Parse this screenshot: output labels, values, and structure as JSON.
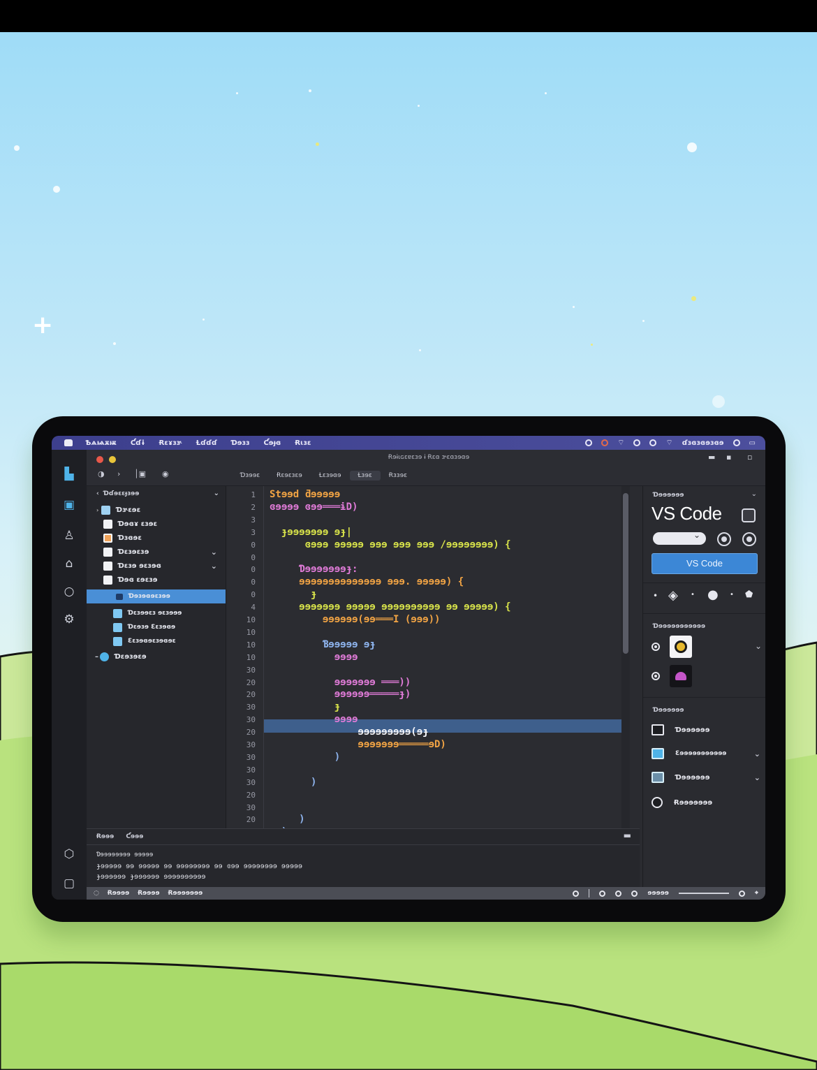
{
  "menubar": {
    "items": [
      "Ѣѧѩѫѭ",
      "Ƈɗɨ",
      "Ɍɛɤɜɝ",
      "Ɫɗɗɗ",
      "Ɗɘɜɜ",
      "Ƈɘɟɞ",
      "Ɍɩɜɛ"
    ],
    "clock": "ɗɜɞɜɞɘɜɞɘ"
  },
  "window": {
    "title": "Ɍɘɨɩɢɛɐɛɜɘ ɨ Ɍɛɞ ɝɛɞɜɘɞɘ"
  },
  "editor_tabs": [
    "Ɗɜɘɘɛ",
    "Ɍɛɘɛɜɛɘ",
    "Ɫɛɜɘɞɘ",
    "Ɫɜɘɛ",
    "Ɍɜɜɘɛ"
  ],
  "explorer": {
    "header": "Ɗɗɘɛɛɟɜɘɘ",
    "items": [
      {
        "label": "Ɗɝɛɘɛ"
      },
      {
        "label": "Ɗɘɞɤ ɛɜɘɛ"
      },
      {
        "label": "Ɗɜɞɘɛ"
      },
      {
        "label": "Ɗɛɜɘɛɜɘ"
      },
      {
        "label": "Ɗɛɜɘ ɘɛɜɘɞ"
      },
      {
        "label": "Ɗɘɞ ɛɘɛɜɘ"
      },
      {
        "label": "Ɗɘɜɘɞɘɛɜɘɘ"
      },
      {
        "label": "Ɗɛɜɘɘɛɜ ɘɛɜɘɘɘ"
      },
      {
        "label": "Ɗɛɘɜɘ Ɛɛɜɘɞɘ"
      },
      {
        "label": "Ɛɛɜɘɞɘɛɜɘɞɘɛ"
      },
      {
        "label": "Ɗɛɘɜɘɛɘ"
      }
    ]
  },
  "code": {
    "line_numbers": [
      "1",
      "2",
      "3",
      "3",
      "0",
      "0",
      "0",
      "0",
      "0",
      "4",
      "10",
      "10",
      "10",
      "10",
      "30",
      "20",
      "20",
      "30",
      "30",
      "20",
      "30",
      "30",
      "30",
      "30",
      "20",
      "30",
      "20",
      "30"
    ],
    "lines": [
      "Stɘɘd ƌɘɘɘɘɘ",
      "ɞɘɘɘɘ ɞɘɘ═══ɨD)",
      "",
      "  ɟɘɘɘɘɘɘɘ ɘɟ|",
      "      ɞɘɘɘ ɘɘɘɘɘ ɘɘɘ ɘɘɘ ɘɘɘ /ɘɘɘɘɘɘɘɘ) {",
      "",
      "     Ɗɘɘɘɘɘɘɘɟ:",
      "     ɘɘɘɘɘɘɘɘɘɘɘɘɘɘ ɘɘɘ. ɘɘɘɘɘ) {",
      "       ɟ",
      "     ɘɘɘɘɘɘɘ ɘɘɘɘɘ ɘɘɘɘɘɘɘɘɘɘ ɘɘ ɘɘɘɘɘ) {",
      "         ɘɘɘɘɘɘ(ɘɘ═══I (ɘɘɘ))",
      "",
      "         Ɓɘɘɘɘɘ ɘɟ",
      "           ɘɘɘɘ",
      "",
      "           ɘɘɘɘɘɘɘ ═══))",
      "           ɘɘɘɘɘɘ═════ɟ)",
      "           ɟ",
      "           ɘɘɘɘ",
      "               ɘɘɘɘɘɘɘɘɘ(ɘɟ",
      "               ɘɘɘɘɘɘɘ═════ɘD)",
      "           )",
      "",
      "       )",
      "",
      "",
      "     )",
      "  )"
    ]
  },
  "panel": {
    "tabs": [
      "Ɍɘɘɘ",
      "Ƈɘɘɘ"
    ],
    "lines": [
      "Ɗɘɘɘɘɘɘɘɘ ɘɘɘɘɘ",
      "ɟɘɘɘɘɘ ɘɘ ɘɘɘɘɘ ɘɘ ɘɘɘɘɘɘɘɘ ɘɘ ɞɘɘ ɘɘɘɘɘɘɘɘ ɘɘɘɘɘ",
      "ɟɘɘɘɘɘɘ ɟɘɘɘɘɘɘ ɘɘɘɘɘɘɘɘɘɘ"
    ]
  },
  "statusbar": {
    "left": [
      "Ɍɘɘɘɘ",
      "Ɍɘɘɘɘ",
      "Ɍɘɘɘɘɘɘɘ"
    ],
    "right_label": "ɘɘɘɘɘ"
  },
  "right_sidebar": {
    "section_label": "Ɗɘɘɘɘɘɘ",
    "title": "VS Code",
    "primary_button": "VS Code",
    "extensions_label": "Ɗɘɘɘɘɘɘɘɘɘɘɘ",
    "outline_label": "Ɗɘɘɘɘɘɘ",
    "outline_items": [
      "Ɗɘɘɘɘɘɘ",
      "Ɛɘɘɘɘɘɘɘɘɘɘɘ",
      "Ɗɘɘɘɘɘɘ",
      "Ɍɘɘɘɘɘɘɘ"
    ]
  },
  "colors": {
    "accent": "#3c87d6",
    "selection": "#4a8fd6",
    "menubar": "#3d3f8d",
    "keyword": "#e07bd8",
    "string": "#f2a444",
    "identifier": "#8eb4ee",
    "function": "#d8e34a"
  },
  "icons": {
    "activity": [
      "explorer-icon",
      "source-control-icon",
      "accounts-icon",
      "home-icon",
      "circle-icon",
      "settings-icon",
      "shield-icon",
      "window-icon"
    ]
  }
}
